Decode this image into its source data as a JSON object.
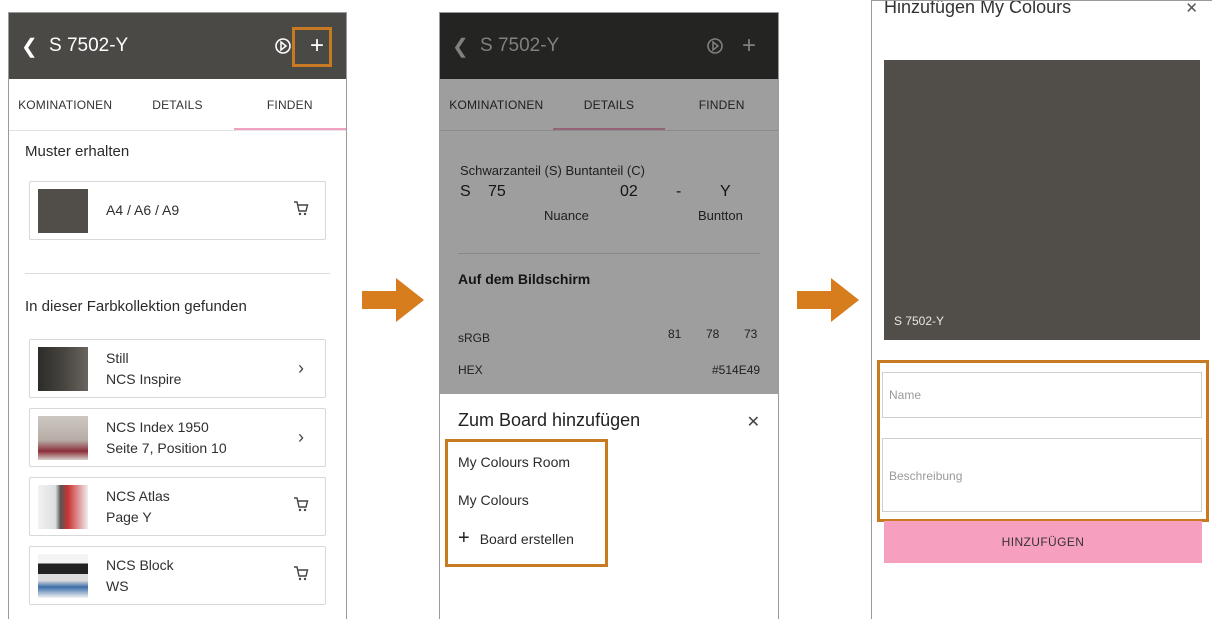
{
  "colors": {
    "swatch": "#514E49",
    "appbar": "#4b4945",
    "highlight": "#c77a22",
    "accent_pink": "#f79fbf"
  },
  "screen1": {
    "title": "S 7502-Y",
    "tabs": [
      "KOMINATIONEN",
      "DETAILS",
      "FINDEN"
    ],
    "samples_title": "Muster erhalten",
    "sample_formats": "A4 / A6 / A9",
    "collections_title": "In dieser Farbkollektion gefunden",
    "items": [
      {
        "line1": "Still",
        "line2": "NCS Inspire",
        "action": "chevron-right-icon"
      },
      {
        "line1": "NCS Index 1950",
        "line2": "Seite 7, Position 10",
        "action": "chevron-right-icon"
      },
      {
        "line1": "NCS Atlas",
        "line2": "Page Y",
        "action": "cart-icon"
      },
      {
        "line1": "NCS Block",
        "line2": "WS",
        "action": "cart-icon"
      }
    ]
  },
  "screen2": {
    "title": "S 7502-Y",
    "tabs": [
      "KOMINATIONEN",
      "DETAILS",
      "FINDEN"
    ],
    "labels_top": "Schwarzanteil (S)  Buntanteil (C)",
    "code": {
      "s": "S",
      "black": "75",
      "chroma": "02",
      "dash": "-",
      "hue": "Y"
    },
    "nuance_label": "Nuance",
    "hue_label": "Buntton",
    "screen_title": "Auf dem Bildschirm",
    "srgb_label": "sRGB",
    "srgb": [
      "81",
      "78",
      "73"
    ],
    "hex_label": "HEX",
    "hex": "#514E49",
    "sheet_title": "Zum Board hinzufügen",
    "boards": [
      "My Colours Room",
      "My Colours"
    ],
    "create_board": "Board erstellen"
  },
  "screen3": {
    "title": "Hinzufügen My Colours",
    "swatch_label": "S 7502-Y",
    "name_placeholder": "Name",
    "description_placeholder": "Beschreibung",
    "submit": "HINZUFÜGEN"
  }
}
